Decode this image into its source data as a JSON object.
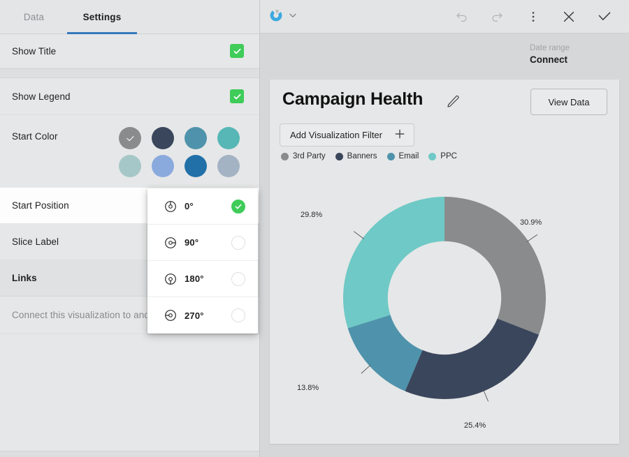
{
  "left_panel": {
    "tabs": [
      {
        "label": "Data",
        "active": false
      },
      {
        "label": "Settings",
        "active": true
      }
    ],
    "accent_color": "#3679bd",
    "checkbox_color": "#3fcc5a",
    "settings": {
      "show_title": {
        "label": "Show Title",
        "checked": true,
        "check_icon": "check-icon"
      },
      "show_legend": {
        "label": "Show Legend",
        "checked": true,
        "check_icon": "check-icon"
      },
      "start_color": {
        "label": "Start Color",
        "selected_index": 0,
        "selected_check_icon": "check-icon",
        "swatches": [
          "#898b8d",
          "#3a465c",
          "#4e93ab",
          "#56b7b6",
          "#a6c7c7",
          "#8aaade",
          "#2170a8",
          "#a3b3c4"
        ]
      },
      "start_position": {
        "label": "Start Position"
      },
      "slice_label": {
        "label": "Slice Label"
      },
      "links": {
        "label": "Links"
      },
      "links_description": {
        "label": "Connect this visualization to anothe"
      }
    },
    "start_position_dropdown": {
      "selected": "0°",
      "options": [
        {
          "label": "0°",
          "icon": "start-position-0-icon",
          "selected": true
        },
        {
          "label": "90°",
          "icon": "start-position-90-icon",
          "selected": false
        },
        {
          "label": "180°",
          "icon": "start-position-180-icon",
          "selected": false
        },
        {
          "label": "270°",
          "icon": "start-position-270-icon",
          "selected": false
        }
      ]
    }
  },
  "right_panel": {
    "toolbar": {
      "viz_type_icon": "donut-chart-icon",
      "viz_type_chevron_icon": "chevron-down-icon",
      "undo_icon": "undo-icon",
      "redo_icon": "redo-icon",
      "more_icon": "more-vertical-icon",
      "close_icon": "close-icon",
      "accept_icon": "check-icon"
    },
    "date_range": {
      "label": "Date range",
      "value": "Connect"
    },
    "card": {
      "title": "Campaign Health",
      "edit_icon": "pencil-icon",
      "view_data_label": "View Data",
      "add_filter_label": "Add Visualization Filter",
      "add_filter_icon": "plus-icon"
    }
  },
  "chart_data": {
    "type": "pie",
    "variant": "donut",
    "title": "Campaign Health",
    "legend_position": "top",
    "start_angle_deg": 0,
    "inner_radius_ratio": 0.56,
    "labels": [
      "3rd Party",
      "Banners",
      "Email",
      "PPC"
    ],
    "values": [
      30.9,
      25.4,
      13.8,
      29.8
    ],
    "value_labels": [
      "30.9%",
      "25.4%",
      "13.8%",
      "29.8%"
    ],
    "colors": [
      "#898b8d",
      "#3a465c",
      "#4e93ab",
      "#6fc9c6"
    ],
    "units": "percent"
  }
}
